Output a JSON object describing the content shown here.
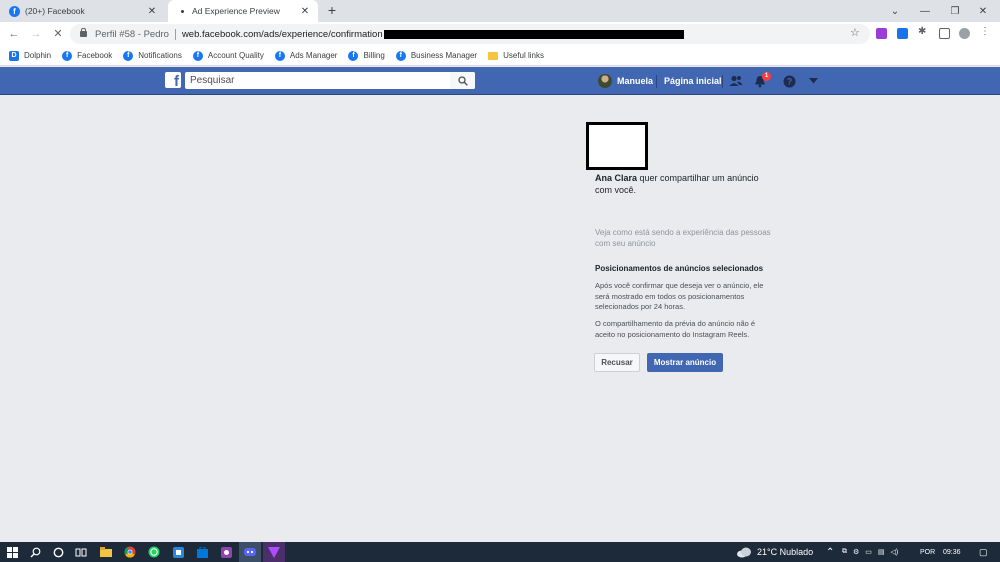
{
  "browser": {
    "tabs": [
      {
        "title": "(20+) Facebook",
        "active": false
      },
      {
        "title": "Ad Experience Preview",
        "active": true
      }
    ],
    "profile": "Perfil #58 - Pedro",
    "url": "web.facebook.com/ads/experience/confirmation",
    "bookmarks": [
      "Dolphin",
      "Facebook",
      "Notifications",
      "Account Quality",
      "Ads Manager",
      "Billing",
      "Business Manager",
      "Useful links"
    ]
  },
  "facebook": {
    "search_placeholder": "Pesquisar",
    "user_name": "Manuela",
    "home_label": "Página inicial",
    "notification_count": "1"
  },
  "content": {
    "sharer_name": "Ana Clara",
    "share_message": " quer compartilhar um anúncio com você.",
    "experience_note": "Veja como está sendo a experiência das pessoas com seu anúncio",
    "placements_title": "Posicionamentos de anúncios selecionados",
    "placements_text": "Após você confirmar que deseja ver o anúncio, ele será mostrado em todos os posicionamentos selecionados por 24 horas.",
    "reels_text": "O compartilhamento da prévia do anúncio não é aceito no posicionamento do Instagram Reels.",
    "decline_label": "Recusar",
    "show_label": "Mostrar anúncio"
  },
  "taskbar": {
    "weather": "21°C  Nublado",
    "language": "POR",
    "time": "09:36"
  },
  "colors": {
    "facebook_blue": "#4267b2",
    "page_background": "#e9ebee",
    "taskbar": "#1c2a3a"
  }
}
